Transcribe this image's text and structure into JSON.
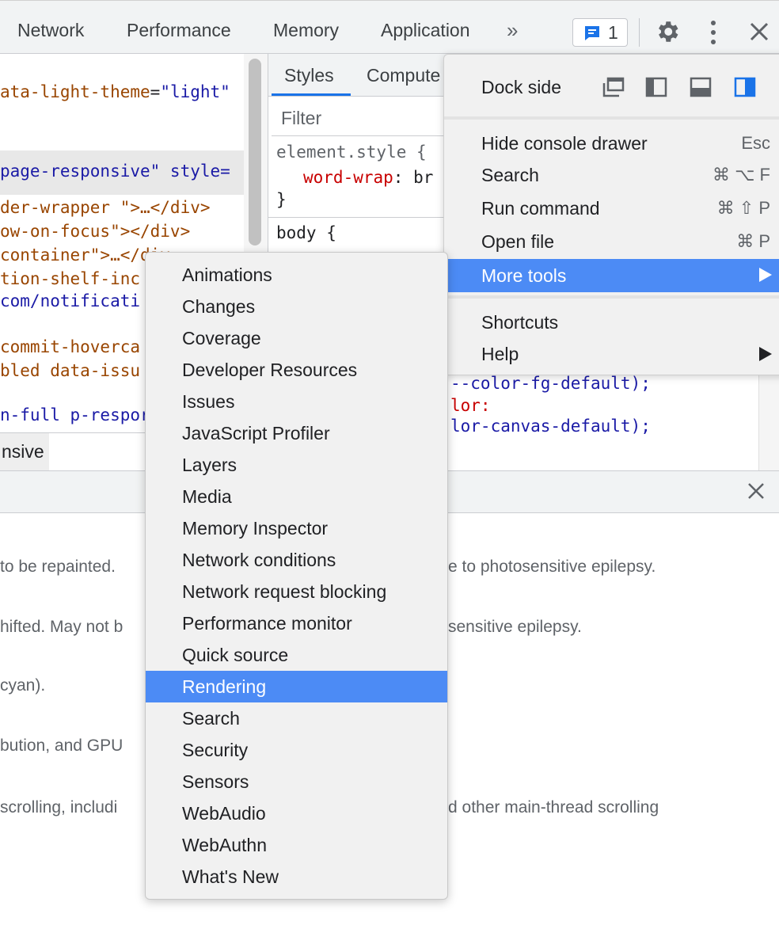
{
  "tabs": [
    "Network",
    "Performance",
    "Memory",
    "Application"
  ],
  "overflow_chevron": "»",
  "issues_count": "1",
  "elements_code": [
    {
      "pre": "",
      "attr": "ata-light-theme",
      "eq": "=",
      "val": "\"light\""
    },
    {
      "pre": "",
      "attr": "",
      "eq": "",
      "val": "page-responsive\" style="
    },
    {
      "line": "der-wrapper \">…</div>"
    },
    {
      "line": "ow-on-focus\"></div>"
    },
    {
      "line": "container\">…</div"
    },
    {
      "line": "tion-shelf-inc"
    },
    {
      "line": "com/notificati"
    },
    {
      "line": "commit-hoverca"
    },
    {
      "line": "bled data-issu"
    },
    {
      "line": "n-full p-respor"
    }
  ],
  "breadcrumb": "nsive",
  "styles_tabs": [
    "Styles",
    "Compute"
  ],
  "filter_placeholder": "Filter",
  "styles_code": {
    "element_style_sel": "element.style {",
    "prop1": "word-wrap",
    "val1": ": br",
    "close1": "}",
    "body_sel": "body {",
    "var1": "--color-fg-default);",
    "prop2": "lor:",
    "var2": "lor-canvas-default);"
  },
  "drawer_text": [
    " to be repainted.",
    "e to photosensitive epilepsy.",
    "hifted. May not b",
    "sensitive epilepsy.",
    "cyan).",
    "bution, and GPU",
    "scrolling, includi",
    "d other main-thread scrolling"
  ],
  "main_menu": {
    "dock_side": "Dock side",
    "items": [
      {
        "label": "Hide console drawer",
        "shortcut": "Esc"
      },
      {
        "label": "Search",
        "shortcut": "⌘ ⌥ F"
      },
      {
        "label": "Run command",
        "shortcut": "⌘ ⇧ P"
      },
      {
        "label": "Open file",
        "shortcut": "⌘ P"
      },
      {
        "label": "More tools",
        "shortcut": ""
      },
      {
        "label": "Shortcuts",
        "shortcut": ""
      },
      {
        "label": "Help",
        "shortcut": ""
      }
    ]
  },
  "more_tools": [
    "Animations",
    "Changes",
    "Coverage",
    "Developer Resources",
    "Issues",
    "JavaScript Profiler",
    "Layers",
    "Media",
    "Memory Inspector",
    "Network conditions",
    "Network request blocking",
    "Performance monitor",
    "Quick source",
    "Rendering",
    "Search",
    "Security",
    "Sensors",
    "WebAudio",
    "WebAuthn",
    "What's New"
  ],
  "colors": {
    "accent": "#4c8bf5",
    "tag": "#881280",
    "attr": "#994500",
    "value": "#1a1aa6"
  }
}
